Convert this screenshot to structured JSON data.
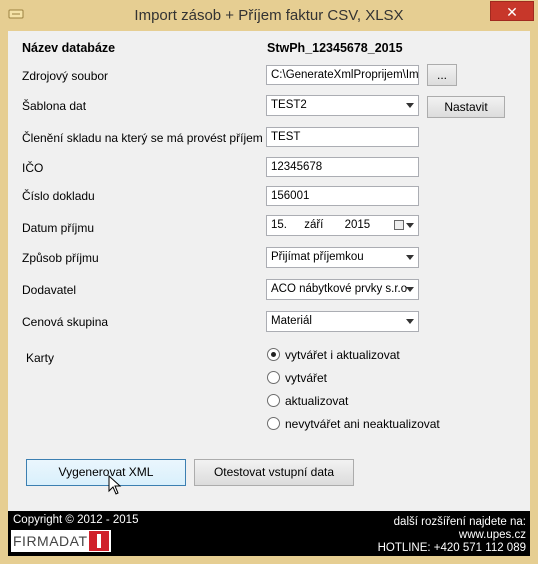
{
  "window": {
    "title": "Import zásob + Příjem faktur CSV, XLSX",
    "close_label": "✕"
  },
  "form": {
    "db_label": "Název databáze",
    "db_value": "StwPh_12345678_2015",
    "source_label": "Zdrojový soubor",
    "source_value": "C:\\GenerateXmlProprijem\\Impo",
    "browse_label": "...",
    "template_label": "Šablona dat",
    "template_value": "TEST2",
    "configure_label": "Nastavit",
    "warehouse_label": "Členění skladu na který se má provést příjem",
    "warehouse_value": "TEST",
    "ico_label": "IČO",
    "ico_value": "12345678",
    "docnum_label": "Číslo dokladu",
    "docnum_value": "156001",
    "date_label": "Datum příjmu",
    "date_day": "15.",
    "date_month": "září",
    "date_year": "2015",
    "method_label": "Způsob příjmu",
    "method_value": "Přijímat příjemkou",
    "supplier_label": "Dodavatel",
    "supplier_value": "ACO nábytkové prvky s.r.o",
    "price_label": "Cenová skupina",
    "price_value": "Materiál",
    "cards_label": "Karty",
    "cards_options": [
      {
        "label": "vytvářet i aktualizovat",
        "checked": true
      },
      {
        "label": "vytvářet",
        "checked": false
      },
      {
        "label": "aktualizovat",
        "checked": false
      },
      {
        "label": "nevytvářet ani neaktualizovat",
        "checked": false
      }
    ],
    "generate_label": "Vygenerovat XML",
    "test_label": "Otestovat vstupní data"
  },
  "footer": {
    "copyright": "Copyright © 2012 - 2015",
    "logo_text": "FIRMADAT",
    "more_ext": "další rozšíření najdete na:",
    "website": "www.upes.cz",
    "hotline": "HOTLINE: +420 571 112 089"
  },
  "colors": {
    "frame": "#e6ce92",
    "close": "#c7372a",
    "logo_red": "#d0202a"
  }
}
